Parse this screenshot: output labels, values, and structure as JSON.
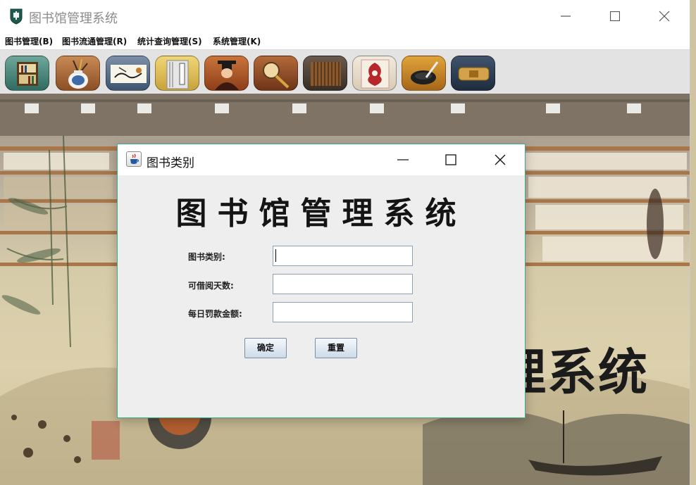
{
  "window": {
    "title": "图书馆管理系统",
    "controls": {
      "minimize_icon": "minimize-icon",
      "maximize_icon": "maximize-icon",
      "close_icon": "close-icon"
    }
  },
  "menubar": {
    "items": [
      {
        "label": "图书管理(B)"
      },
      {
        "label": "图书流通管理(R)"
      },
      {
        "label": "统计查询管理(S)"
      },
      {
        "label": "系统管理(K)"
      }
    ]
  },
  "toolbar": {
    "buttons": [
      {
        "icon": "bookshelf-icon"
      },
      {
        "icon": "porcelain-vase-icon"
      },
      {
        "icon": "ink-painting-icon"
      },
      {
        "icon": "thread-bound-book-icon"
      },
      {
        "icon": "traditional-scholar-icon"
      },
      {
        "icon": "magnifier-fan-icon"
      },
      {
        "icon": "bamboo-slips-icon"
      },
      {
        "icon": "paper-cut-icon"
      },
      {
        "icon": "inkstone-brush-icon"
      },
      {
        "icon": "treasure-box-icon"
      }
    ]
  },
  "background": {
    "calligraphy": "理系统"
  },
  "dialog": {
    "title": "图书类别",
    "banner": "图书馆管理系统",
    "fields": [
      {
        "label": "图书类别:",
        "value": ""
      },
      {
        "label": "可借阅天数:",
        "value": ""
      },
      {
        "label": "每日罚款金额:",
        "value": ""
      }
    ],
    "buttons": {
      "confirm": "确定",
      "reset": "重置"
    }
  },
  "colors": {
    "dialog_border": "#3fae82",
    "field_border": "#8ea1b6",
    "button_top": "#f4f8fc",
    "button_bottom": "#cddbe9"
  }
}
